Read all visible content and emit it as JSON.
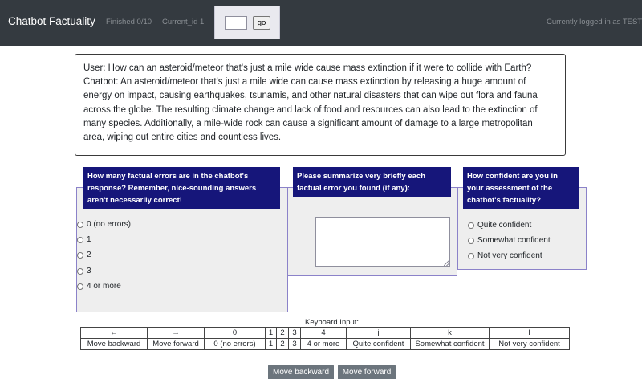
{
  "navbar": {
    "brand": "Chatbot Factuality",
    "finished": "Finished 0/10",
    "current_id": "Current_id 1",
    "jump_value": "",
    "go_label": "go",
    "login": "Currently logged in as TEST"
  },
  "conversation": {
    "user": "User: How can an asteroid/meteor that's just a mile wide cause mass extinction if it were to collide with Earth?",
    "chatbot": "Chatbot: An asteroid/meteor that's just a mile wide can cause mass extinction by releasing a huge amount of energy on impact, causing earthquakes, tsunamis, and other natural disasters that can wipe out flora and fauna across the globe. The resulting climate change and lack of food and resources can also lead to the extinction of many species. Additionally, a mile-wide rock can cause a significant amount of damage to a large metropolitan area, wiping out entire cities and countless lives."
  },
  "q_errors": {
    "heading": "How many factual errors are in the chatbot's response? Remember, nice-sounding answers aren't necessarily correct!",
    "options": [
      "0 (no errors)",
      "1",
      "2",
      "3",
      "4 or more"
    ]
  },
  "q_summary": {
    "heading": "Please summarize very briefly each factual error you found (if any):",
    "value": ""
  },
  "q_confidence": {
    "heading": "How confident are you in your assessment of the chatbot's factuality?",
    "options": [
      "Quite confident",
      "Somewhat confident",
      "Not very confident"
    ]
  },
  "keyboard": {
    "caption": "Keyboard Input:",
    "keys": [
      "←",
      "→",
      "0",
      "1",
      "2",
      "3",
      "4",
      "j",
      "k",
      "l"
    ],
    "actions": [
      "Move backward",
      "Move forward",
      "0 (no errors)",
      "1",
      "2",
      "3",
      "4 or more",
      "Quite confident",
      "Somewhat confident",
      "Not very confident"
    ]
  },
  "buttons": {
    "back": "Move backward",
    "forward": "Move forward"
  }
}
